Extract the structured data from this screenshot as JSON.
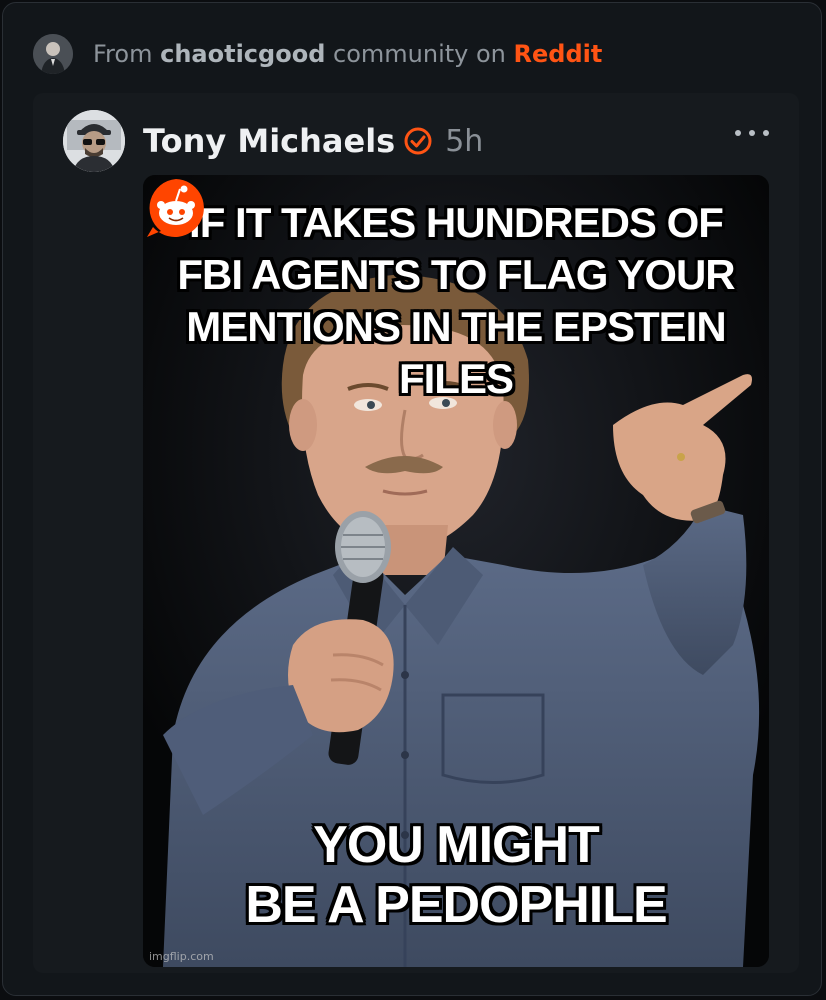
{
  "source": {
    "prefix": "From",
    "community": "chaoticgood",
    "middle": "community on",
    "platform": "Reddit"
  },
  "post": {
    "author": "Tony Michaels",
    "time": "5h",
    "more_label": "More options",
    "meme": {
      "top_text": "IF IT TAKES HUNDREDS OF FBI AGENTS TO FLAG YOUR MENTIONS IN THE EPSTEIN FILES",
      "bottom_text_line1": "YOU MIGHT",
      "bottom_text_line2": "BE A PEDOPHILE",
      "watermark": "imgflip.com"
    }
  },
  "colors": {
    "accent": "#ff5414",
    "background": "#12161a",
    "card": "#161a1e"
  },
  "icons": {
    "verified": "verified-check-icon",
    "more": "more-horizontal-icon",
    "reddit": "reddit-snoo-icon"
  }
}
